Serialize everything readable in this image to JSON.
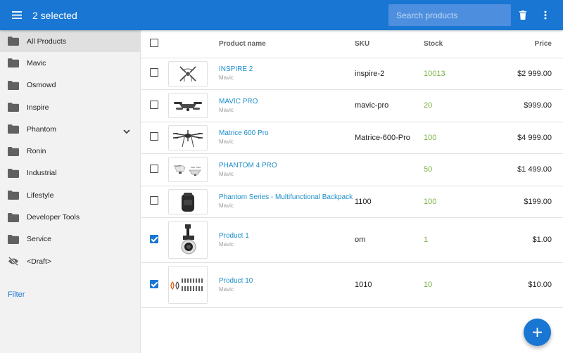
{
  "header": {
    "title": "2 selected",
    "search_placeholder": "Search products",
    "menu_icon": "menu-icon",
    "delete_icon": "trash-icon",
    "more_icon": "more-vert-icon",
    "bar_color": "#1976d2"
  },
  "sidebar": {
    "items": [
      {
        "label": "All Products",
        "icon": "folder-icon",
        "active": true
      },
      {
        "label": "Mavic",
        "icon": "folder-icon"
      },
      {
        "label": "Osmowd",
        "icon": "folder-icon"
      },
      {
        "label": "Inspire",
        "icon": "folder-icon"
      },
      {
        "label": "Phantom",
        "icon": "folder-icon",
        "expandable": true
      },
      {
        "label": "Ronin",
        "icon": "folder-icon"
      },
      {
        "label": "Industrial",
        "icon": "folder-icon"
      },
      {
        "label": "Lifestyle",
        "icon": "folder-icon"
      },
      {
        "label": "Developer Tools",
        "icon": "folder-icon"
      },
      {
        "label": "Service",
        "icon": "folder-icon"
      },
      {
        "label": "<Draft>",
        "icon": "eye-off-icon"
      }
    ],
    "filter_label": "Filter"
  },
  "table": {
    "columns": {
      "name": "Product name",
      "sku": "SKU",
      "stock": "Stock",
      "price": "Price"
    },
    "rows": [
      {
        "name": "INSPIRE 2",
        "category": "Mavic",
        "sku": "inspire-2",
        "stock": "10013",
        "price": "$2 999.00",
        "checked": false,
        "image": "inspire-drone-image"
      },
      {
        "name": "MAVIC PRO",
        "category": "Mavic",
        "sku": "mavic-pro",
        "stock": "20",
        "price": "$999.00",
        "checked": false,
        "image": "mavic-drone-image"
      },
      {
        "name": "Matrice 600 Pro",
        "category": "Mavic",
        "sku": "Matrice-600-Pro",
        "stock": "100",
        "price": "$4 999.00",
        "checked": false,
        "image": "matrice-drone-image"
      },
      {
        "name": "PHANTOM 4 PRO",
        "category": "Mavic",
        "sku": "",
        "stock": "50",
        "price": "$1 499.00",
        "checked": false,
        "image": "phantom-drone-image"
      },
      {
        "name": "Phantom Series - Multifunctional Backpack",
        "category": "Mavic",
        "sku": "1100",
        "stock": "100",
        "price": "$199.00",
        "checked": false,
        "image": "backpack-image"
      },
      {
        "name": "Product 1",
        "category": "Mavic",
        "sku": "om",
        "stock": "1",
        "price": "$1.00",
        "checked": true,
        "image": "gimbal-camera-image"
      },
      {
        "name": "Product 10",
        "category": "Mavic",
        "sku": "1010",
        "stock": "10",
        "price": "$10.00",
        "checked": true,
        "image": "propellers-image"
      }
    ]
  },
  "fab_icon": "plus-icon",
  "colors": {
    "accent": "#1976d2",
    "link": "#1c8ec9",
    "stock": "#7cb342"
  }
}
